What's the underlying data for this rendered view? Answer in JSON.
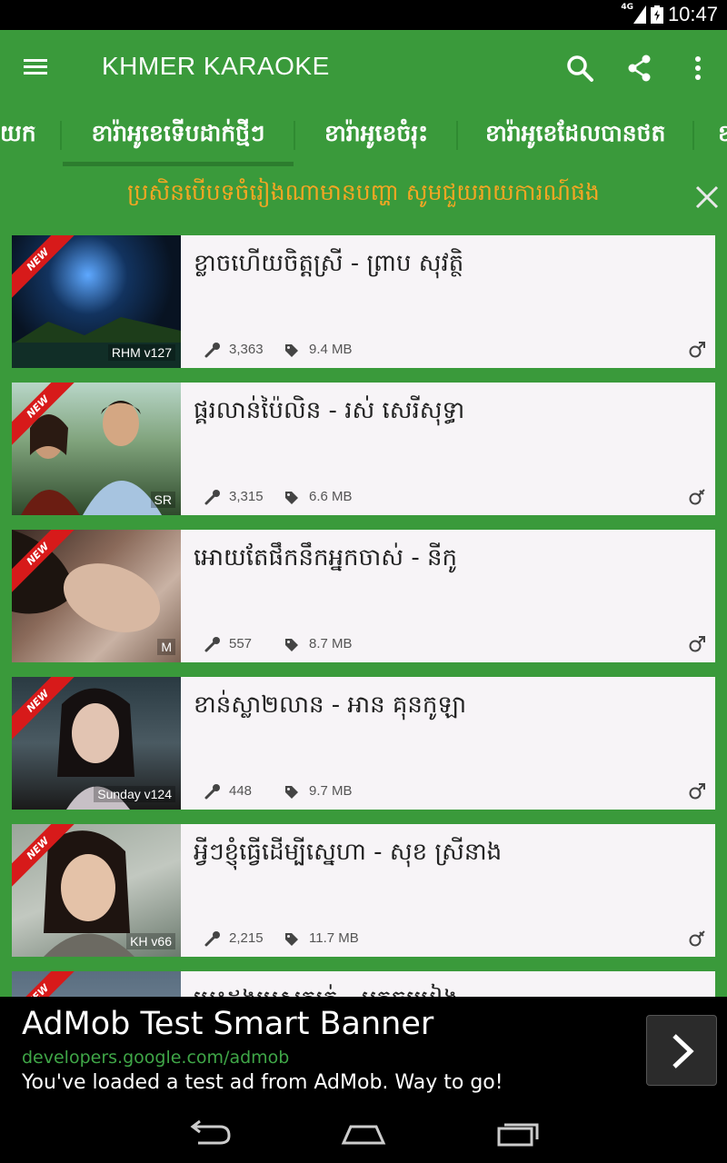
{
  "status_bar": {
    "network": "4G",
    "time": "10:47"
  },
  "app_bar": {
    "title": "KHMER KARAOKE",
    "menu_icon": "menu-icon",
    "actions": [
      "search-icon",
      "share-icon",
      "more-vert-icon"
    ]
  },
  "tabs": [
    {
      "label": "យក"
    },
    {
      "label": "ខារ៉ាអូខេទើបដាក់ថ្មីៗ",
      "active": true
    },
    {
      "label": "ខារ៉ាអូខេចំរុះ"
    },
    {
      "label": "ខារ៉ាអូខេដែលបានថត"
    },
    {
      "label": "ខ"
    }
  ],
  "notice": {
    "text": "ប្រសិនបើបទចំរៀងណាមានបញ្ហា សូមជួយរាយការណ៍ផង",
    "close_icon": "close-icon"
  },
  "songs": [
    {
      "badge": "NEW",
      "title": "ខ្លាចហើយចិត្តស្រី - ព្រាប សុវត្ថិ",
      "version": "RHM v127",
      "plays": "3,363",
      "size": "9.4 MB",
      "gender": "male"
    },
    {
      "badge": "NEW",
      "title": "ផ្គរលាន់ប៉ៃលិន - រស់ សេរីសុទ្ធា",
      "version": "SR",
      "plays": "3,315",
      "size": "6.6 MB",
      "gender": "male-female"
    },
    {
      "badge": "NEW",
      "title": "អោយតែផឹកនឹកអ្នកចាស់ - នីកូ",
      "version": "M",
      "plays": "557",
      "size": "8.7 MB",
      "gender": "male"
    },
    {
      "badge": "NEW",
      "title": "ខាន់ស្លា២លាន - អាន គុនកូឡា",
      "version": "Sunday v124",
      "plays": "448",
      "size": "9.7 MB",
      "gender": "male"
    },
    {
      "badge": "NEW",
      "title": "អ្វីៗខ្ញុំធ្វើដើម្បីស្នេហា - សុខ ស្រីនាង",
      "version": "KH v66",
      "plays": "2,215",
      "size": "11.7 MB",
      "gender": "male-female"
    },
    {
      "badge": "NEW",
      "title": "បេះដូងប្រុសក្បត់ - អ្នកចម្រៀង"
    }
  ],
  "ad": {
    "headline": "AdMob Test Smart Banner",
    "url": "developers.google.com/admob",
    "description": "You've loaded a test ad from AdMob. Way to go!",
    "cta_icon": "chevron-right-icon"
  },
  "nav_bar": [
    "back-icon",
    "home-icon",
    "recents-icon"
  ],
  "colors": {
    "primary": "#3a9a3b",
    "accent": "#f5a623",
    "badge": "#d71a1a",
    "card": "#f7f4f7"
  }
}
